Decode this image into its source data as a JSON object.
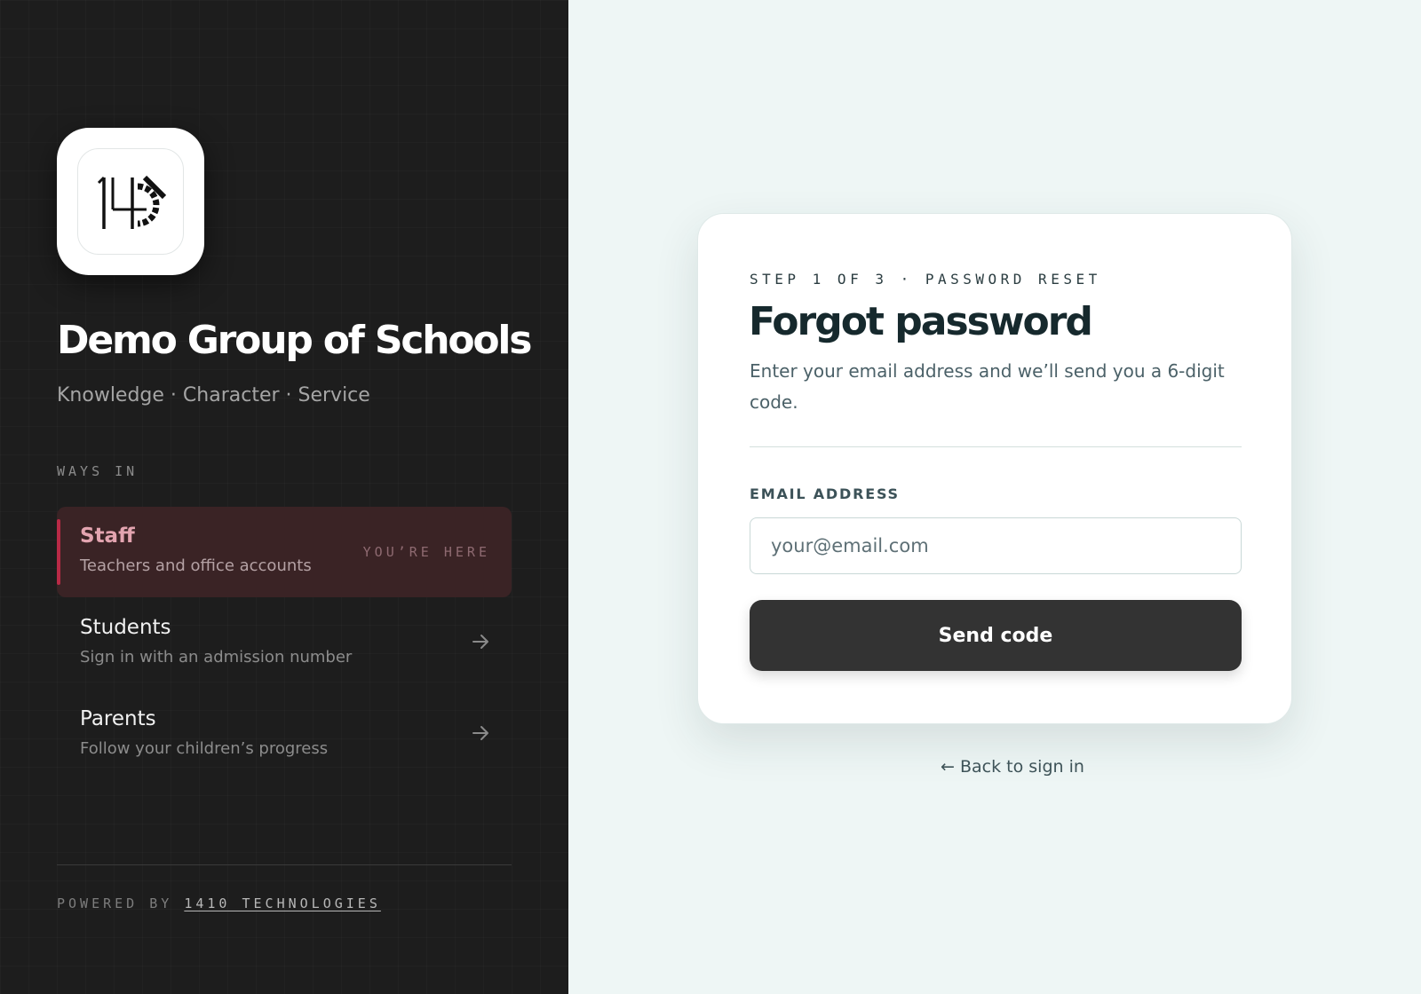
{
  "brand": {
    "logo_icon": "1410-logo-icon",
    "name": "Demo Group of Schools",
    "motto": "Knowledge · Character · Service"
  },
  "ways_in": {
    "label": "WAYS IN",
    "items": [
      {
        "title": "Staff",
        "subtitle": "Teachers and office accounts",
        "badge": "YOU’RE HERE",
        "active": true
      },
      {
        "title": "Students",
        "subtitle": "Sign in with an admission number",
        "icon": "arrow-right-icon"
      },
      {
        "title": "Parents",
        "subtitle": "Follow your children’s progress",
        "icon": "arrow-right-icon"
      }
    ]
  },
  "footer": {
    "powered_prefix": "POWERED BY ",
    "powered_link": "1410 TECHNOLOGIES"
  },
  "card": {
    "step": "STEP 1 OF 3 · PASSWORD RESET",
    "title": "Forgot password",
    "description": "Enter your email address and we’ll send you a 6-digit code.",
    "email_label": "EMAIL ADDRESS",
    "email_placeholder": "your@email.com",
    "email_value": "",
    "submit_label": "Send code"
  },
  "back_link": "← Back to sign in",
  "colors": {
    "left_bg": "#1d1d1d",
    "right_bg": "#eef6f5",
    "accent": "#b82a46",
    "active_bg": "#3a2325",
    "button_bg": "#333333"
  }
}
